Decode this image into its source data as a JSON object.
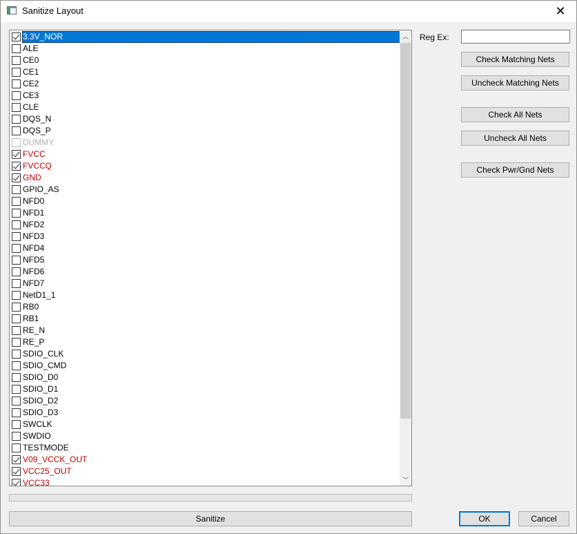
{
  "window": {
    "title": "Sanitize Layout",
    "close_glyph": "✕"
  },
  "nets": [
    {
      "name": "3.3V_NOR",
      "checked": true,
      "style": "selected"
    },
    {
      "name": "ALE",
      "checked": false,
      "style": "normal"
    },
    {
      "name": "CE0",
      "checked": false,
      "style": "normal"
    },
    {
      "name": "CE1",
      "checked": false,
      "style": "normal"
    },
    {
      "name": "CE2",
      "checked": false,
      "style": "normal"
    },
    {
      "name": "CE3",
      "checked": false,
      "style": "normal"
    },
    {
      "name": "CLE",
      "checked": false,
      "style": "normal"
    },
    {
      "name": "DQS_N",
      "checked": false,
      "style": "normal"
    },
    {
      "name": "DQS_P",
      "checked": false,
      "style": "normal"
    },
    {
      "name": "DUMMY",
      "checked": false,
      "style": "gray"
    },
    {
      "name": "FVCC",
      "checked": true,
      "style": "red"
    },
    {
      "name": "FVCCQ",
      "checked": true,
      "style": "red"
    },
    {
      "name": "GND",
      "checked": true,
      "style": "red"
    },
    {
      "name": "GPIO_AS",
      "checked": false,
      "style": "normal"
    },
    {
      "name": "NFD0",
      "checked": false,
      "style": "normal"
    },
    {
      "name": "NFD1",
      "checked": false,
      "style": "normal"
    },
    {
      "name": "NFD2",
      "checked": false,
      "style": "normal"
    },
    {
      "name": "NFD3",
      "checked": false,
      "style": "normal"
    },
    {
      "name": "NFD4",
      "checked": false,
      "style": "normal"
    },
    {
      "name": "NFD5",
      "checked": false,
      "style": "normal"
    },
    {
      "name": "NFD6",
      "checked": false,
      "style": "normal"
    },
    {
      "name": "NFD7",
      "checked": false,
      "style": "normal"
    },
    {
      "name": "NetD1_1",
      "checked": false,
      "style": "normal"
    },
    {
      "name": "RB0",
      "checked": false,
      "style": "normal"
    },
    {
      "name": "RB1",
      "checked": false,
      "style": "normal"
    },
    {
      "name": "RE_N",
      "checked": false,
      "style": "normal"
    },
    {
      "name": "RE_P",
      "checked": false,
      "style": "normal"
    },
    {
      "name": "SDIO_CLK",
      "checked": false,
      "style": "normal"
    },
    {
      "name": "SDIO_CMD",
      "checked": false,
      "style": "normal"
    },
    {
      "name": "SDIO_D0",
      "checked": false,
      "style": "normal"
    },
    {
      "name": "SDIO_D1",
      "checked": false,
      "style": "normal"
    },
    {
      "name": "SDIO_D2",
      "checked": false,
      "style": "normal"
    },
    {
      "name": "SDIO_D3",
      "checked": false,
      "style": "normal"
    },
    {
      "name": "SWCLK",
      "checked": false,
      "style": "normal"
    },
    {
      "name": "SWDIO",
      "checked": false,
      "style": "normal"
    },
    {
      "name": "TESTMODE",
      "checked": false,
      "style": "normal"
    },
    {
      "name": "V09_VCCK_OUT",
      "checked": true,
      "style": "red"
    },
    {
      "name": "VCC25_OUT",
      "checked": true,
      "style": "red"
    },
    {
      "name": "VCC33",
      "checked": true,
      "style": "red"
    }
  ],
  "scrollbar": {
    "up_glyph": "︿",
    "down_glyph": "﹀"
  },
  "regex": {
    "label": "Reg Ex:",
    "value": ""
  },
  "buttons": {
    "check_matching": "Check Matching Nets",
    "uncheck_matching": "Uncheck Matching Nets",
    "check_all": "Check All Nets",
    "uncheck_all": "Uncheck All Nets",
    "check_pwr_gnd": "Check Pwr/Gnd Nets",
    "sanitize": "Sanitize",
    "ok": "OK",
    "cancel": "Cancel"
  },
  "progress": {
    "value": 0
  },
  "colors": {
    "power_net": "#c00000",
    "disabled_net": "#b0b0b0",
    "selection": "#0078d7"
  }
}
